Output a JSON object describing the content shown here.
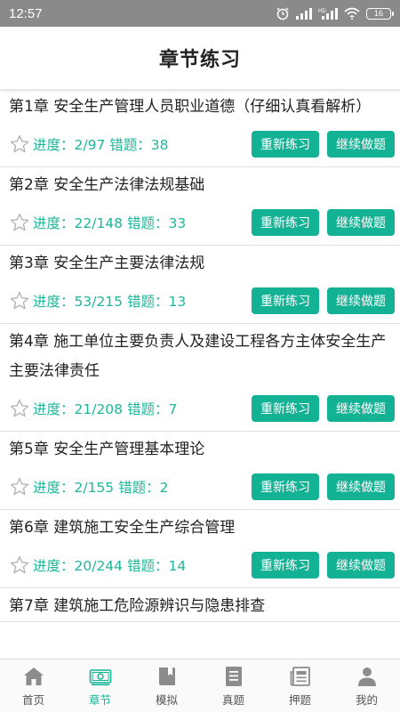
{
  "status_bar": {
    "time": "12:57",
    "battery": "16"
  },
  "header": {
    "title": "章节练习"
  },
  "labels": {
    "restart": "重新练习",
    "continue": "继续做题"
  },
  "chapters": [
    {
      "title": "第1章 安全生产管理人员职业道德（仔细认真看解析）",
      "progress": "进度：2/97 错题：38"
    },
    {
      "title": "第2章 安全生产法律法规基础",
      "progress": "进度：22/148 错题：33"
    },
    {
      "title": "第3章 安全生产主要法律法规",
      "progress": "进度：53/215 错题：13"
    },
    {
      "title": "第4章 施工单位主要负责人及建设工程各方主体安全生产主要法律责任",
      "progress": "进度：21/208 错题：7"
    },
    {
      "title": "第5章 安全生产管理基本理论",
      "progress": "进度：2/155 错题：2"
    },
    {
      "title": "第6章 建筑施工安全生产综合管理",
      "progress": "进度：20/244 错题：14"
    },
    {
      "title": "第7章 建筑施工危险源辨识与隐患排查",
      "progress": ""
    }
  ],
  "nav": [
    {
      "label": "首页",
      "icon": "home-icon"
    },
    {
      "label": "章节",
      "icon": "banknote-icon",
      "active": true
    },
    {
      "label": "模拟",
      "icon": "book-icon"
    },
    {
      "label": "真题",
      "icon": "document-icon"
    },
    {
      "label": "押题",
      "icon": "newspaper-icon"
    },
    {
      "label": "我的",
      "icon": "user-icon"
    }
  ],
  "colors": {
    "accent": "#13b295",
    "progress_text": "#1fb59a",
    "status_bar": "#8a8a8a",
    "nav_icon": "#8c8c8c"
  }
}
